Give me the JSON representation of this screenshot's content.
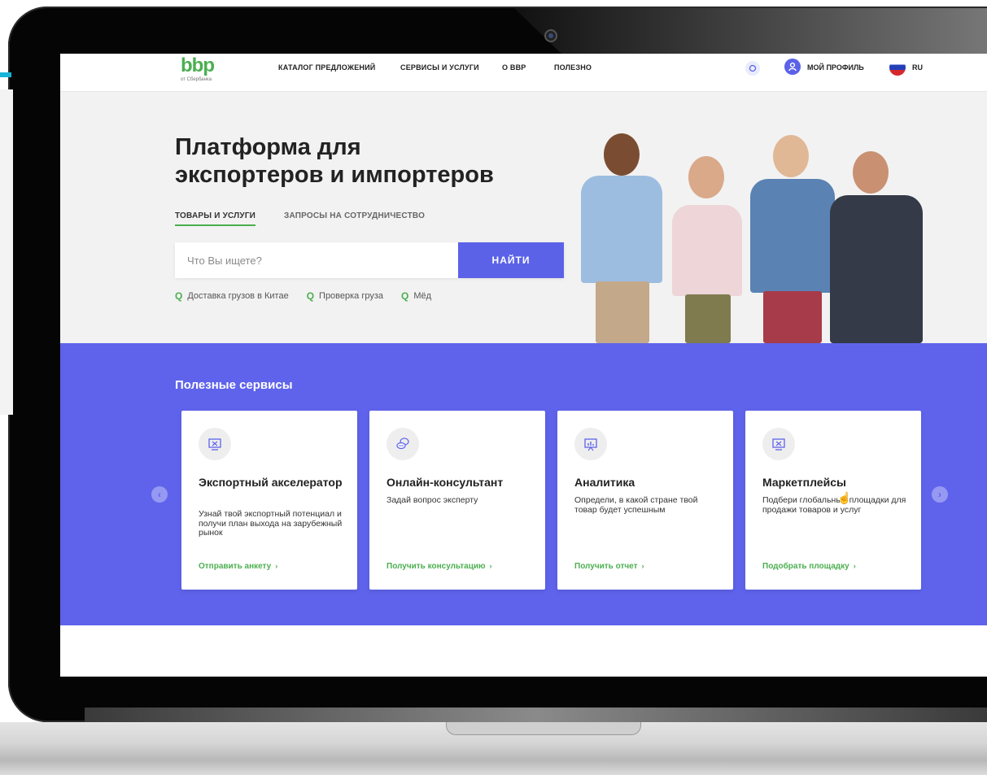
{
  "nav": {
    "logo": "bbp",
    "logo_sub": "от Сбербанка",
    "links": [
      "КАТАЛОГ ПРЕДЛОЖЕНИЙ",
      "СЕРВИСЫ И УСЛУГИ",
      "О ВВР",
      "ПОЛЕЗНО"
    ],
    "profile": "МОЙ ПРОФИЛЬ",
    "lang": "RU"
  },
  "hero": {
    "title_line1": "Платформа для",
    "title_line2": "экспортеров и импортеров",
    "tabs": [
      "ТОВАРЫ И УСЛУГИ",
      "ЗАПРОСЫ НА СОТРУДНИЧЕСТВО"
    ],
    "search_placeholder": "Что Вы ищете?",
    "search_button": "НАЙТИ",
    "suggestions": [
      "Доставка грузов в Китае",
      "Проверка груза",
      "Мёд"
    ]
  },
  "services": {
    "title": "Полезные сервисы",
    "cards": [
      {
        "title": "Экспортный акселератор",
        "text": "Узнай твой экспортный потенциал и получи план выхода на зарубежный рынок",
        "link": "Отправить анкету"
      },
      {
        "title": "Онлайн-консультант",
        "text": "Задай вопрос эксперту",
        "link": "Получить консультацию"
      },
      {
        "title": "Аналитика",
        "text": "Определи, в какой стране твой товар будет успешным",
        "link": "Получить отчет"
      },
      {
        "title": "Маркетплейсы",
        "text": "Подбери глобальные площадки для продажи товаров и услуг",
        "link": "Подобрать площадку"
      }
    ]
  },
  "colors": {
    "accent": "#5f63eb",
    "brand_green": "#4caf50"
  },
  "icons": {
    "card_0": "accelerator-board-icon",
    "card_1": "chat-bubble-icon",
    "card_2": "analytics-board-icon",
    "card_3": "marketplace-board-icon"
  }
}
